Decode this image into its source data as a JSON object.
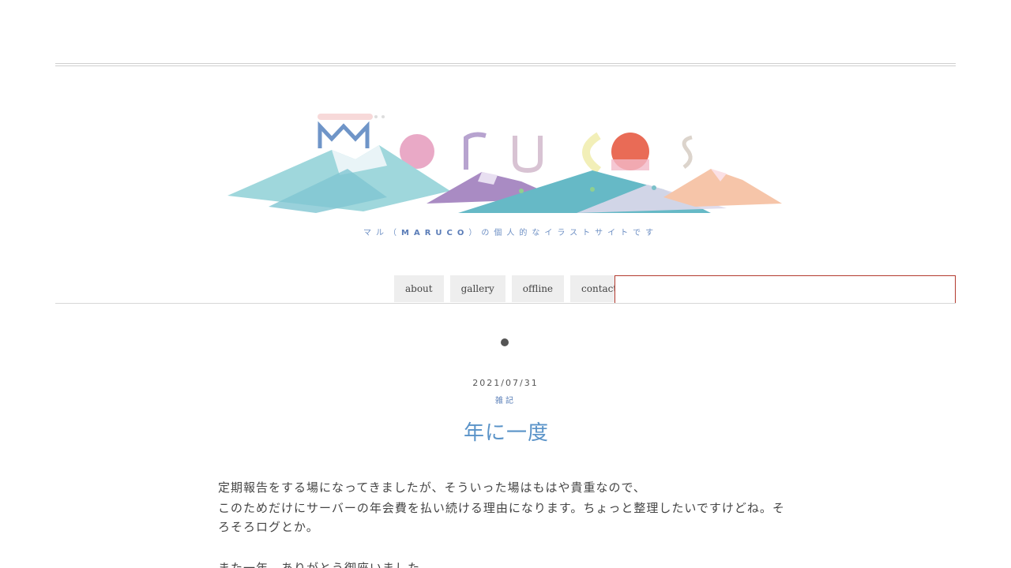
{
  "site": {
    "tagline_prefix": "マル（",
    "tagline_bold": "MARUCO",
    "tagline_suffix": "）の個人的なイラストサイトです"
  },
  "nav": {
    "items": [
      {
        "label": "about"
      },
      {
        "label": "gallery"
      },
      {
        "label": "offline"
      },
      {
        "label": "contact"
      }
    ],
    "search_value": ""
  },
  "post": {
    "date": "2021/07/31",
    "category": "雑記",
    "title": "年に一度",
    "paragraphs": [
      "定期報告をする場になってきましたが、そういった場はもはや貴重なので、",
      "このためだけにサーバーの年会費を払い続ける理由になります。ちょっと整理したいですけどね。そ",
      "ろそろログとか。",
      "また一年、ありがとう御座いました"
    ]
  },
  "colors": {
    "accent": "#5a93c8",
    "tagline": "#6d8fc4",
    "search_border": "#b33a2e",
    "logo_pink": "#e9a9c6",
    "logo_sun": "#e96b56",
    "logo_mountain": "#9fd7dc"
  }
}
